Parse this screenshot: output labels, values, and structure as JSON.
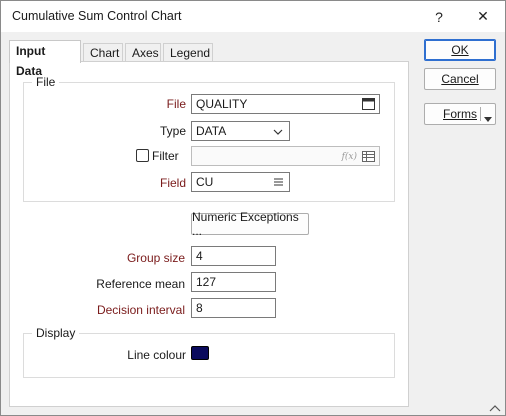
{
  "window": {
    "title": "Cumulative Sum Control Chart",
    "help_glyph": "?",
    "close_glyph": "✕"
  },
  "tabs": [
    {
      "label": "Input Data",
      "active": true
    },
    {
      "label": "Chart",
      "active": false
    },
    {
      "label": "Axes",
      "active": false
    },
    {
      "label": "Legend",
      "active": false
    }
  ],
  "file_group": {
    "title": "File",
    "file_label": "File",
    "file_value": "QUALITY",
    "type_label": "Type",
    "type_value": "DATA",
    "filter_label": "Filter",
    "filter_checked": false,
    "filter_value": "",
    "filter_fx_glyph": "f(x)",
    "field_label": "Field",
    "field_value": "CU"
  },
  "numeric_exceptions_label": "Numeric Exceptions ...",
  "params": {
    "group_size_label": "Group size",
    "group_size_value": "4",
    "reference_mean_label": "Reference mean",
    "reference_mean_value": "127",
    "decision_interval_label": "Decision interval",
    "decision_interval_value": "8"
  },
  "display_group": {
    "title": "Display",
    "line_colour_label": "Line colour",
    "line_colour": "#0a0a5c"
  },
  "buttons": {
    "ok": "OK",
    "cancel": "Cancel",
    "forms": "Forms"
  },
  "colors": {
    "required_label": "#7a1b1b",
    "primary_border": "#2f6fd0"
  }
}
